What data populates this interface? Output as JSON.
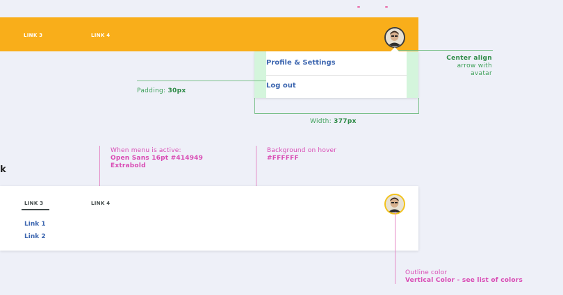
{
  "top_nav": {
    "links": [
      "LINK 3",
      "LINK 4"
    ],
    "bg_color": "#F9AE1A"
  },
  "dropdown": {
    "items": [
      "Profile & Settings",
      "Log out"
    ]
  },
  "annotations": {
    "center_align": [
      "Center align",
      "arrow with",
      "avatar"
    ],
    "padding_label": "Padding:",
    "padding_value": "30px",
    "width_label": "Width:",
    "width_value": "377px",
    "menu_active": [
      "When menu is active:",
      "Open Sans 16pt #414949",
      "Extrabold"
    ],
    "hover": [
      "Background on hover",
      "#FFFFFF"
    ],
    "outline": [
      "Outline color",
      "Vertical Color - see list of colors"
    ]
  },
  "section_fragment": "k",
  "bottom_nav": {
    "links": [
      "LINK 3",
      "LINK 4"
    ],
    "sub_links": [
      "Link 1",
      "Link 2"
    ]
  },
  "colors": {
    "accent_orange": "#F9AE1A",
    "annotation_green": "#3FA15A",
    "annotation_pink": "#D94BB4",
    "link_blue": "#3E67B0",
    "text_dark": "#414949"
  }
}
